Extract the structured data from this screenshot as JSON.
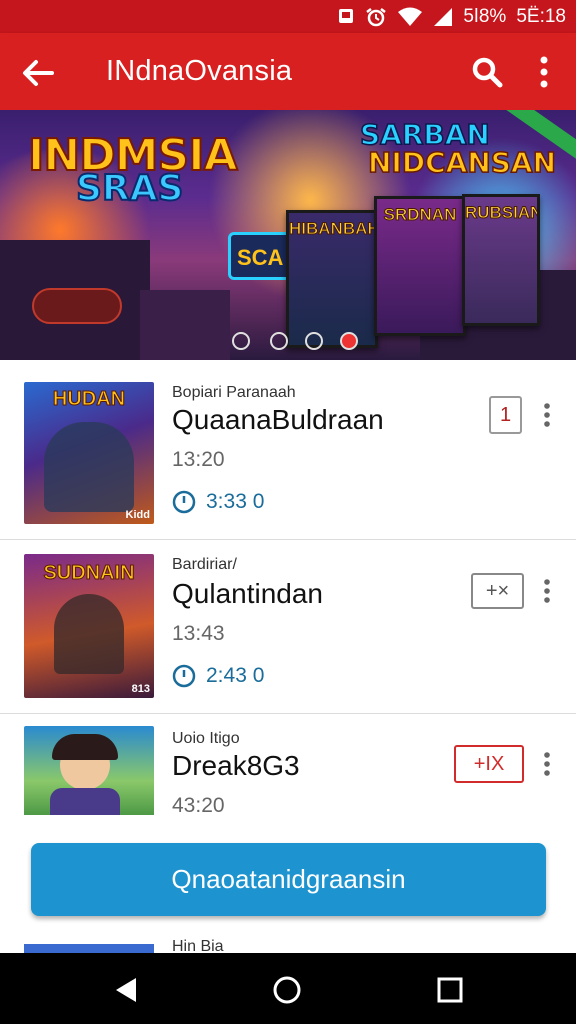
{
  "status_bar": {
    "battery_text": "5ǀ8%",
    "clock": "5Ё:18",
    "icons": [
      "message-icon",
      "alarm-icon",
      "wifi-icon",
      "signal-icon"
    ]
  },
  "app_bar": {
    "title": "INdnaOvansia",
    "back_icon": "arrow-left-icon",
    "search_icon": "search-icon",
    "menu_icon": "more-vert-icon"
  },
  "banner": {
    "logo_left_line1": "INDMSIA",
    "logo_left_line2": "SRAS",
    "logo_right_line1": "SARBAN",
    "logo_right_line2": "NIDCANSAN",
    "card_titles": [
      "HIBANBAH",
      "SRDNAN",
      "RUBSIAN"
    ],
    "side_label": "SCA"
  },
  "items": [
    {
      "subtitle": "Bopiari Paranaah",
      "name": "QuaanaBuldraan",
      "time": "13:20",
      "duration": "3:33 0",
      "thumb_title": "HUDAN",
      "thumb_badge": "Kidd",
      "action_label": "1",
      "action_color": "#b22222"
    },
    {
      "subtitle": "Bardiriar/",
      "name": "Qulantindan",
      "time": "13:43",
      "duration": "2:43 0",
      "thumb_title": "SUDNAIN",
      "thumb_badge": "813",
      "action_label": "+×",
      "action_color": "#555555"
    },
    {
      "subtitle": "Uoio Itigo",
      "name": "Dreak8G3",
      "time": "43:20",
      "duration": "",
      "thumb_title": "",
      "thumb_badge": "",
      "action_label": "+IX",
      "action_color": "#d22b2b"
    }
  ],
  "cta": {
    "label": "Qnaoatanidgraansin"
  },
  "peek_item": {
    "subtitle": "Hin Bia"
  },
  "nav_bar": {
    "back_icon": "nav-back-icon",
    "home_icon": "nav-home-icon",
    "recents_icon": "nav-recents-icon"
  },
  "colors": {
    "status_bar": "#c4161c",
    "app_bar": "#d7201f",
    "cta": "#1d93cf",
    "duration_text": "#1a6c9a"
  }
}
